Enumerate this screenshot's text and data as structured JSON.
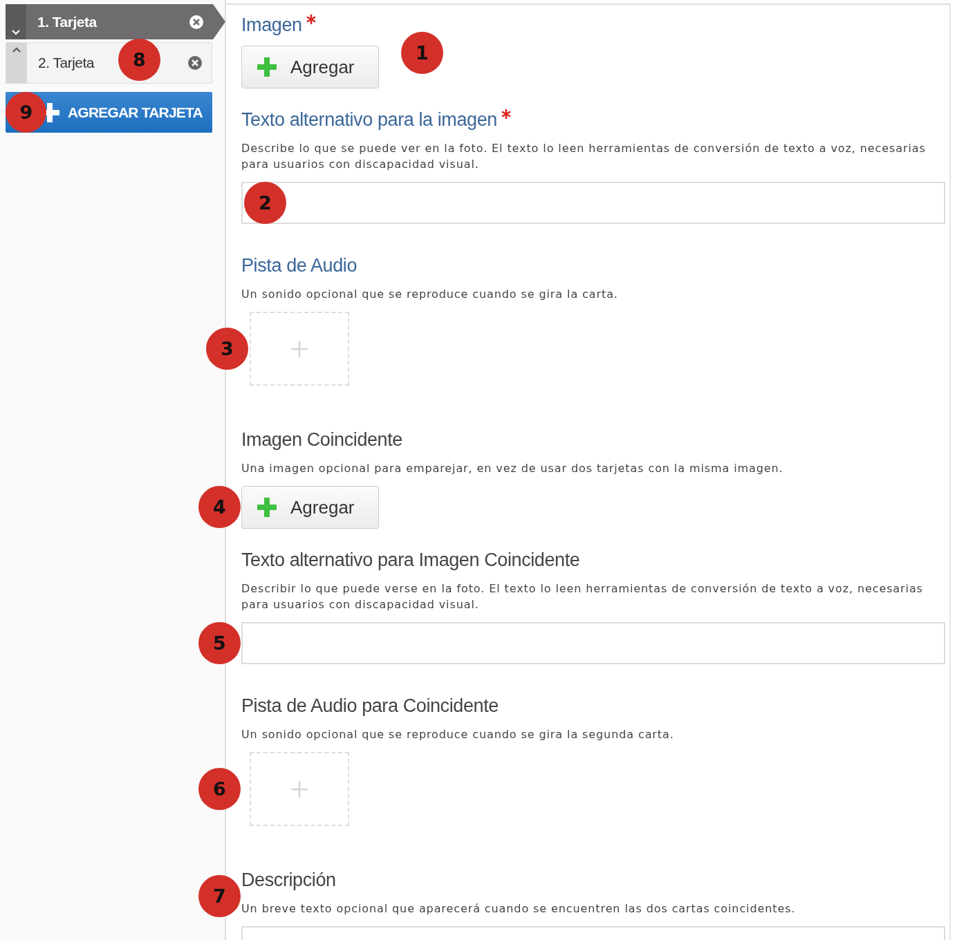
{
  "sidebar": {
    "cards": [
      {
        "label": "1. Tarjeta",
        "selected": true
      },
      {
        "label": "2. Tarjeta",
        "selected": false,
        "callout": "8"
      }
    ],
    "add_button": {
      "label": "AGREGAR TARJETA",
      "callout": "9"
    }
  },
  "fields": [
    {
      "kind": "image",
      "title": "Imagen",
      "required": true,
      "active": true,
      "button": "Agregar",
      "callout": "1"
    },
    {
      "kind": "text",
      "title": "Texto alternativo para la imagen",
      "required": true,
      "active": true,
      "description": "Describe lo que se puede ver en la foto. El texto lo leen herramientas de conversión de texto a voz, necesarias para usuarios con discapacidad visual.",
      "callout": "2"
    },
    {
      "kind": "audio",
      "title": "Pista de Audio",
      "required": false,
      "active": true,
      "description": "Un sonido opcional que se reproduce cuando se gira la carta.",
      "callout": "3"
    },
    {
      "kind": "image",
      "title": "Imagen Coincidente",
      "required": false,
      "active": false,
      "description": "Una imagen opcional para emparejar, en vez de usar dos tarjetas con la misma imagen.",
      "button": "Agregar",
      "callout": "4"
    },
    {
      "kind": "text",
      "title": "Texto alternativo para Imagen Coincidente",
      "required": false,
      "active": false,
      "description": "Describir lo que puede verse en la foto. El texto lo leen herramientas de conversión de texto a voz, necesarias para usuarios con discapacidad visual.",
      "callout": "5"
    },
    {
      "kind": "audio",
      "title": "Pista de Audio para Coincidente",
      "required": false,
      "active": false,
      "description": "Un sonido opcional que se reproduce cuando se gira la segunda carta.",
      "callout": "6"
    },
    {
      "kind": "text",
      "title": "Descripción",
      "required": false,
      "active": false,
      "description": "Un breve texto opcional que aparecerá cuando se encuentren las dos cartas coincidentes.",
      "callout": "7"
    }
  ]
}
